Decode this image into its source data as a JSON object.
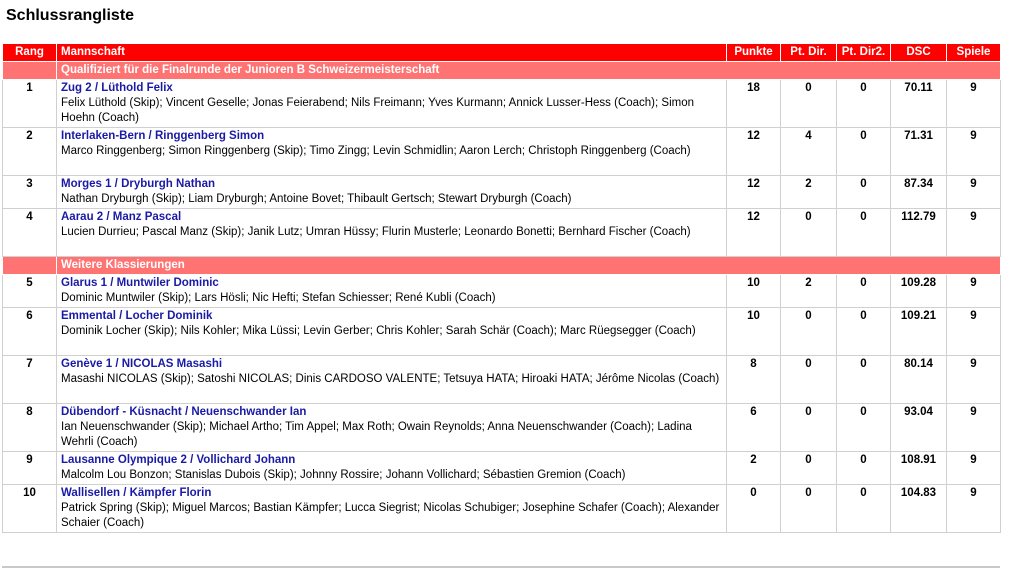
{
  "page_title": "Schlussrangliste",
  "columns": {
    "rank": "Rang",
    "team": "Mannschaft",
    "points": "Punkte",
    "pt_dir": "Pt. Dir.",
    "pt_dir2": "Pt. Dir2.",
    "dsc": "DSC",
    "games": "Spiele"
  },
  "colors": {
    "header_bg": "#ff0000",
    "section_bg": "#ff7373",
    "link": "#1a1aa6"
  },
  "sections": [
    {
      "title": "Qualifiziert für die Finalrunde der Junioren B Schweizermeisterschaft",
      "rows": [
        {
          "rank": "1",
          "team": "Zug 2 / Lüthold Felix",
          "players": "Felix Lüthold (Skip); Vincent Geselle; Jonas Feierabend; Nils Freimann; Yves Kurmann; Annick Lusser-Hess (Coach); Simon Hoehn (Coach)",
          "points": "18",
          "pt_dir": "0",
          "pt_dir2": "0",
          "dsc": "70.11",
          "games": "9"
        },
        {
          "rank": "2",
          "team": "Interlaken-Bern / Ringgenberg Simon",
          "players": "Marco Ringgenberg; Simon Ringgenberg (Skip); Timo Zingg; Levin Schmidlin; Aaron Lerch; Christoph Ringgenberg (Coach)",
          "points": "12",
          "pt_dir": "4",
          "pt_dir2": "0",
          "dsc": "71.31",
          "games": "9"
        },
        {
          "rank": "3",
          "team": "Morges 1 / Dryburgh Nathan",
          "players": "Nathan Dryburgh (Skip); Liam Dryburgh; Antoine Bovet; Thibault Gertsch; Stewart Dryburgh (Coach)",
          "points": "12",
          "pt_dir": "2",
          "pt_dir2": "0",
          "dsc": "87.34",
          "games": "9"
        },
        {
          "rank": "4",
          "team": "Aarau 2 / Manz Pascal",
          "players": "Lucien Durrieu; Pascal Manz (Skip); Janik Lutz; Umran Hüssy; Flurin Musterle; Leonardo Bonetti; Bernhard Fischer (Coach)",
          "points": "12",
          "pt_dir": "0",
          "pt_dir2": "0",
          "dsc": "112.79",
          "games": "9"
        }
      ]
    },
    {
      "title": "Weitere Klassierungen",
      "rows": [
        {
          "rank": "5",
          "team": "Glarus 1 / Muntwiler Dominic",
          "players": "Dominic Muntwiler (Skip); Lars Hösli; Nic Hefti; Stefan Schiesser; René Kubli (Coach)",
          "points": "10",
          "pt_dir": "2",
          "pt_dir2": "0",
          "dsc": "109.28",
          "games": "9"
        },
        {
          "rank": "6",
          "team": "Emmental / Locher Dominik",
          "players": "Dominik Locher (Skip); Nils Kohler; Mika Lüssi; Levin Gerber; Chris Kohler; Sarah Schär (Coach); Marc Rüegsegger (Coach)",
          "points": "10",
          "pt_dir": "0",
          "pt_dir2": "0",
          "dsc": "109.21",
          "games": "9"
        },
        {
          "rank": "7",
          "team": "Genève 1 / NICOLAS Masashi",
          "players": "Masashi NICOLAS (Skip); Satoshi NICOLAS; Dinis CARDOSO VALENTE; Tetsuya HATA; Hiroaki HATA; Jérôme Nicolas (Coach)",
          "points": "8",
          "pt_dir": "0",
          "pt_dir2": "0",
          "dsc": "80.14",
          "games": "9"
        },
        {
          "rank": "8",
          "team": "Dübendorf - Küsnacht / Neuenschwander Ian",
          "players": "Ian Neuenschwander (Skip); Michael Artho; Tim Appel; Max Roth; Owain Reynolds; Anna Neuenschwander (Coach); Ladina Wehrli (Coach)",
          "points": "6",
          "pt_dir": "0",
          "pt_dir2": "0",
          "dsc": "93.04",
          "games": "9"
        },
        {
          "rank": "9",
          "team": "Lausanne Olympique 2 / Vollichard Johann",
          "players": "Malcolm Lou Bonzon; Stanislas Dubois (Skip); Johnny Rossire; Johann Vollichard; Sébastien Gremion (Coach)",
          "points": "2",
          "pt_dir": "0",
          "pt_dir2": "0",
          "dsc": "108.91",
          "games": "9"
        },
        {
          "rank": "10",
          "team": "Wallisellen / Kämpfer Florin",
          "players": "Patrick Spring (Skip); Miguel Marcos; Bastian Kämpfer; Lucca Siegrist; Nicolas Schubiger; Josephine Schafer (Coach); Alexander Schaier (Coach)",
          "points": "0",
          "pt_dir": "0",
          "pt_dir2": "0",
          "dsc": "104.83",
          "games": "9"
        }
      ]
    }
  ]
}
